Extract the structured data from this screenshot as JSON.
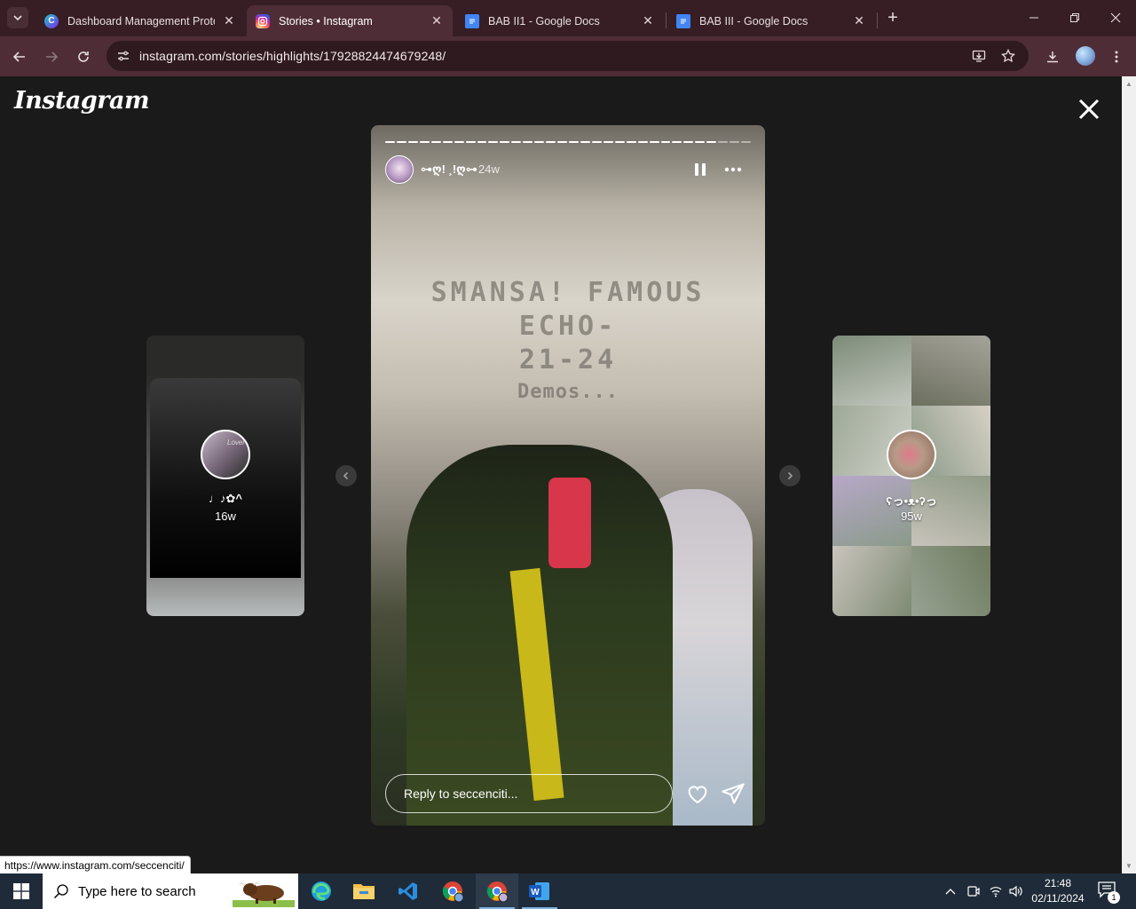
{
  "browser": {
    "tabs": [
      {
        "title": "Dashboard Management Protot",
        "active": false
      },
      {
        "title": "Stories • Instagram",
        "active": true
      },
      {
        "title": "BAB II1 - Google Docs",
        "active": false
      },
      {
        "title": "BAB III - Google Docs",
        "active": false
      }
    ],
    "url": "instagram.com/stories/highlights/17928824474679248/",
    "status_link": "https://www.instagram.com/seccenciti/"
  },
  "instagram": {
    "logo": "Instagram",
    "story": {
      "username": "⊶ღ! ¸!ღ⊶",
      "time": "24w",
      "reply_placeholder": "Reply to seccenciti...",
      "progress_segments_total": 32,
      "progress_segments_done": 29,
      "wall_text": "SMANSA! FAMOUS\nECHO-\n21-24",
      "wall_text_2": "Demos..."
    },
    "prev_highlight": {
      "name": "♩♪✿^",
      "time": "16w",
      "avatar_label": "Lover"
    },
    "next_highlight": {
      "name": "ʕっ•ᴥ•ʔっ",
      "time": "95w"
    }
  },
  "taskbar": {
    "search_placeholder": "Type here to search",
    "time": "21:48",
    "date": "02/11/2024",
    "notification_count": "1"
  },
  "colors": {
    "tabstrip": "#361e24",
    "toolbar": "#4f2d36",
    "page_bg": "#1a1a1a",
    "taskbar": "#1f2b38"
  }
}
